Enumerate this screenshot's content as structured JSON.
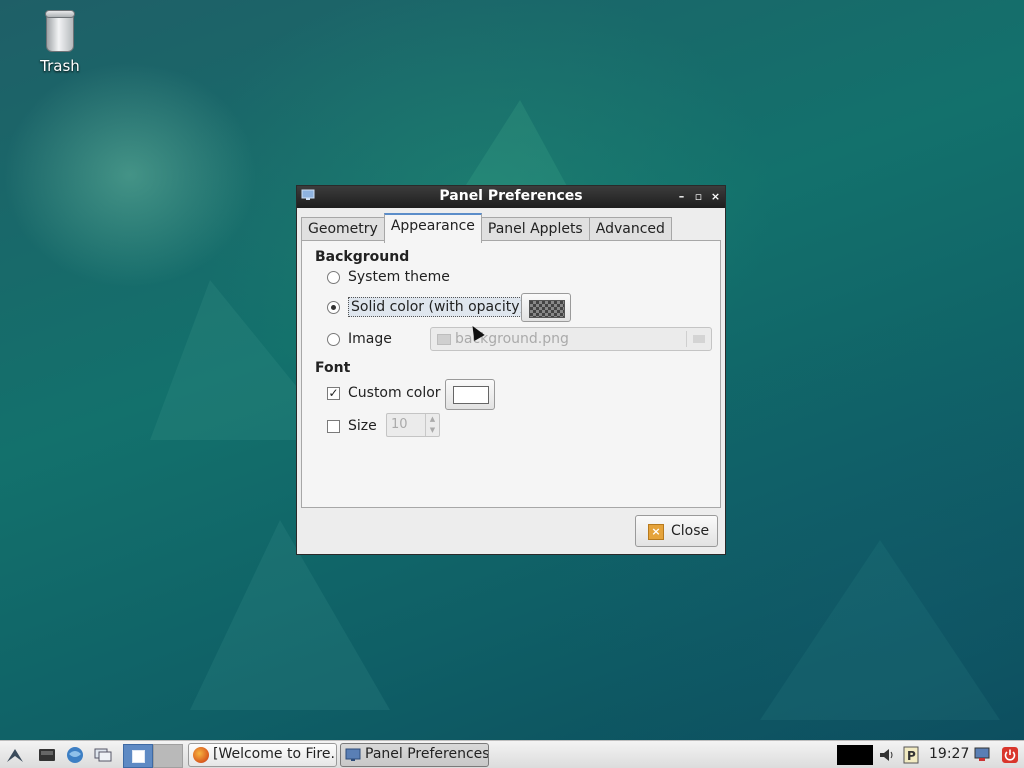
{
  "desktop": {
    "icons": [
      {
        "label": "Trash",
        "icon": "trash-icon"
      }
    ]
  },
  "dialog": {
    "title": "Panel Preferences",
    "window_buttons": {
      "minimize": "–",
      "maximize": "▫",
      "close": "×"
    },
    "tabs": [
      {
        "label": "Geometry",
        "active": false
      },
      {
        "label": "Appearance",
        "active": true
      },
      {
        "label": "Panel Applets",
        "active": false
      },
      {
        "label": "Advanced",
        "active": false
      }
    ],
    "background": {
      "heading": "Background",
      "system_theme": "System theme",
      "solid_color": "Solid color (with opacity)",
      "image": "Image",
      "image_file": "background.png",
      "selected": "solid_color"
    },
    "font": {
      "heading": "Font",
      "custom_color": "Custom color",
      "custom_color_checked": true,
      "size": "Size",
      "size_checked": false,
      "size_value": "10"
    },
    "close_label": "Close"
  },
  "taskbar": {
    "tasks": [
      {
        "label": "[Welcome to Fire...",
        "icon": "firefox-icon",
        "active": false
      },
      {
        "label": "Panel Preferences",
        "icon": "monitor-icon",
        "active": true
      }
    ],
    "clock": "19:27"
  }
}
